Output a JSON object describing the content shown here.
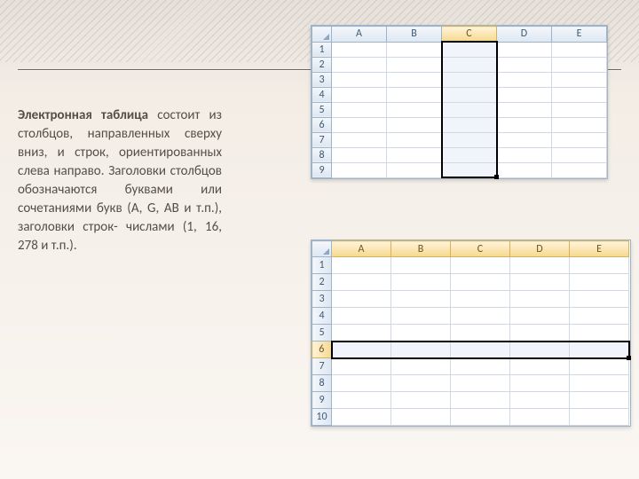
{
  "text": {
    "lead": "Электронная таблица",
    "body": " состоит из столбцов, направленных сверху вниз, и строк, ориентированных слева направо. Заголовки столбцов обозначаются буквами или сочетаниями букв (A, G, AB и т.п.), заголовки строк- числами (1, 16, 278 и т.п.)."
  },
  "sheet1": {
    "cols": [
      "A",
      "B",
      "C",
      "D",
      "E"
    ],
    "rows": [
      "1",
      "2",
      "3",
      "4",
      "5",
      "6",
      "7",
      "8",
      "9"
    ],
    "selectedCol": "C"
  },
  "sheet2": {
    "cols": [
      "A",
      "B",
      "C",
      "D",
      "E"
    ],
    "rows": [
      "1",
      "2",
      "3",
      "4",
      "5",
      "6",
      "7",
      "8",
      "9",
      "10"
    ],
    "selectedRow": "6"
  }
}
